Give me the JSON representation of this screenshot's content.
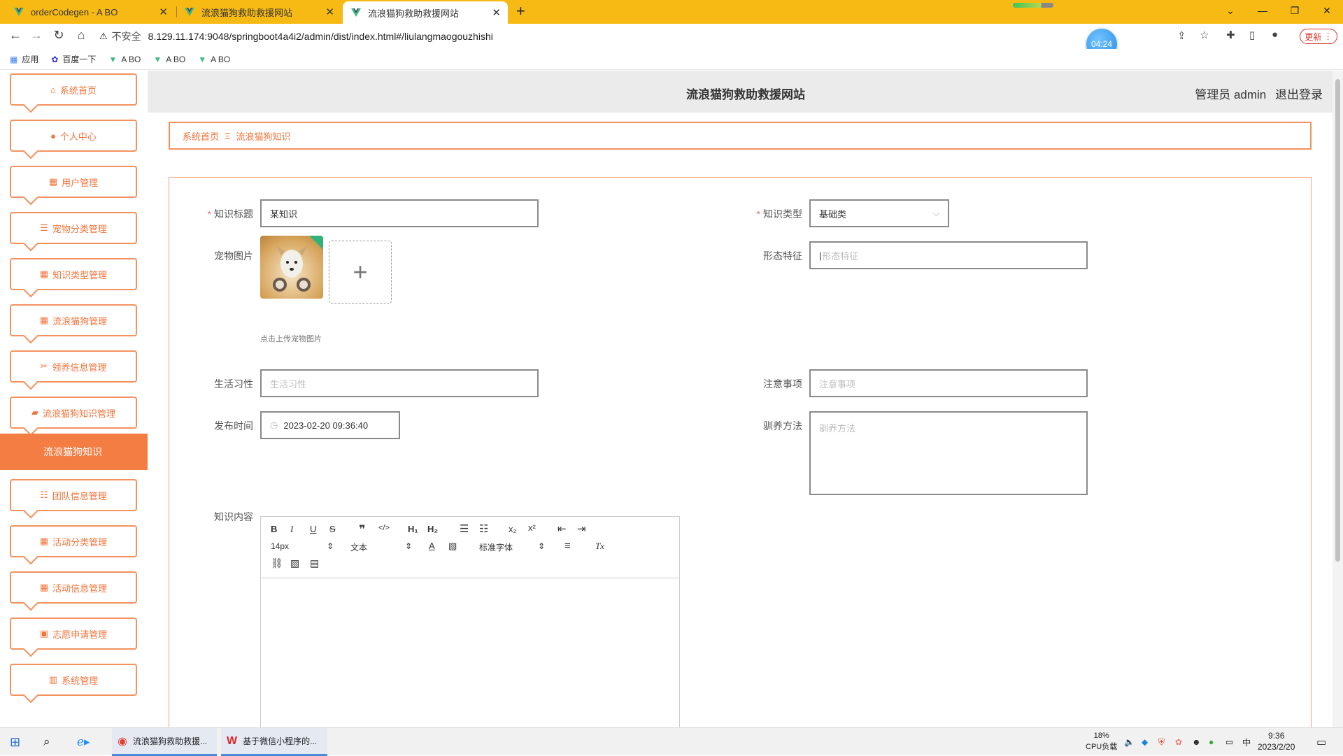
{
  "browser": {
    "tabs": [
      {
        "title": "orderCodegen - A BO"
      },
      {
        "title": "流浪猫狗救助救援网站"
      },
      {
        "title": "流浪猫狗救助救援网站"
      }
    ],
    "address": {
      "security_label": "不安全",
      "url": "8.129.11.174:9048/springboot4a4i2/admin/dist/index.html#/liulangmaogouzhishi"
    },
    "timer": "04:24",
    "update_label": "更新",
    "bookmarks": [
      {
        "label": "应用",
        "icon": "apps-grid-icon"
      },
      {
        "label": "百度一下",
        "icon": "baidu-paw-icon"
      },
      {
        "label": "A BO",
        "icon": "vue-logo-icon"
      },
      {
        "label": "A BO",
        "icon": "vue-logo-icon"
      },
      {
        "label": "A BO",
        "icon": "vue-logo-icon"
      }
    ]
  },
  "sidebar": {
    "items": [
      {
        "label": "系统首页",
        "icon": "home-icon"
      },
      {
        "label": "个人中心",
        "icon": "user-icon"
      },
      {
        "label": "用户管理",
        "icon": "grid-icon"
      },
      {
        "label": "宠物分类管理",
        "icon": "list-icon"
      },
      {
        "label": "知识类型管理",
        "icon": "grid-icon"
      },
      {
        "label": "流浪猫狗管理",
        "icon": "grid-icon"
      },
      {
        "label": "领养信息管理",
        "icon": "ticket-icon"
      },
      {
        "label": "流浪猫狗知识管理",
        "icon": "briefcase-icon"
      },
      {
        "label": "团队信息管理",
        "icon": "sliders-icon"
      },
      {
        "label": "活动分类管理",
        "icon": "grid-icon"
      },
      {
        "label": "活动信息管理",
        "icon": "grid-icon"
      },
      {
        "label": "志愿申请管理",
        "icon": "clipboard-icon"
      },
      {
        "label": "系统管理",
        "icon": "bar-chart-icon"
      }
    ],
    "active_sub": "流浪猫狗知识"
  },
  "header": {
    "title": "流浪猫狗救助救援网站",
    "role": "管理员 admin",
    "logout": "退出登录"
  },
  "breadcrumb": {
    "home": "系统首页",
    "sep": "Ξ",
    "current": "流浪猫狗知识"
  },
  "form": {
    "title": {
      "label": "知识标题",
      "value": "某知识"
    },
    "type": {
      "label": "知识类型",
      "value": "基础类"
    },
    "image": {
      "label": "宠物图片",
      "hint": "点击上传宠物图片"
    },
    "features": {
      "label": "形态特征",
      "placeholder": "形态特征"
    },
    "habits": {
      "label": "生活习性",
      "placeholder": "生活习性"
    },
    "notes": {
      "label": "注意事项",
      "placeholder": "注意事项"
    },
    "publish_time": {
      "label": "发布时间",
      "value": "2023-02-20 09:36:40"
    },
    "training": {
      "label": "驯养方法",
      "placeholder": "驯养方法"
    },
    "content": {
      "label": "知识内容",
      "font_size": "14px",
      "block_type": "文本",
      "font_family": "标准字体"
    }
  },
  "taskbar": {
    "apps": [
      {
        "label": "流浪猫狗救助救援..."
      },
      {
        "label": "基于微信小程序的..."
      }
    ],
    "cpu_value": "18%",
    "cpu_label": "CPU负载",
    "ime": "中",
    "time": "9:36",
    "date": "2023/2/20"
  },
  "colors": {
    "accent": "#f47d44",
    "tabbar": "#f7ba14"
  }
}
